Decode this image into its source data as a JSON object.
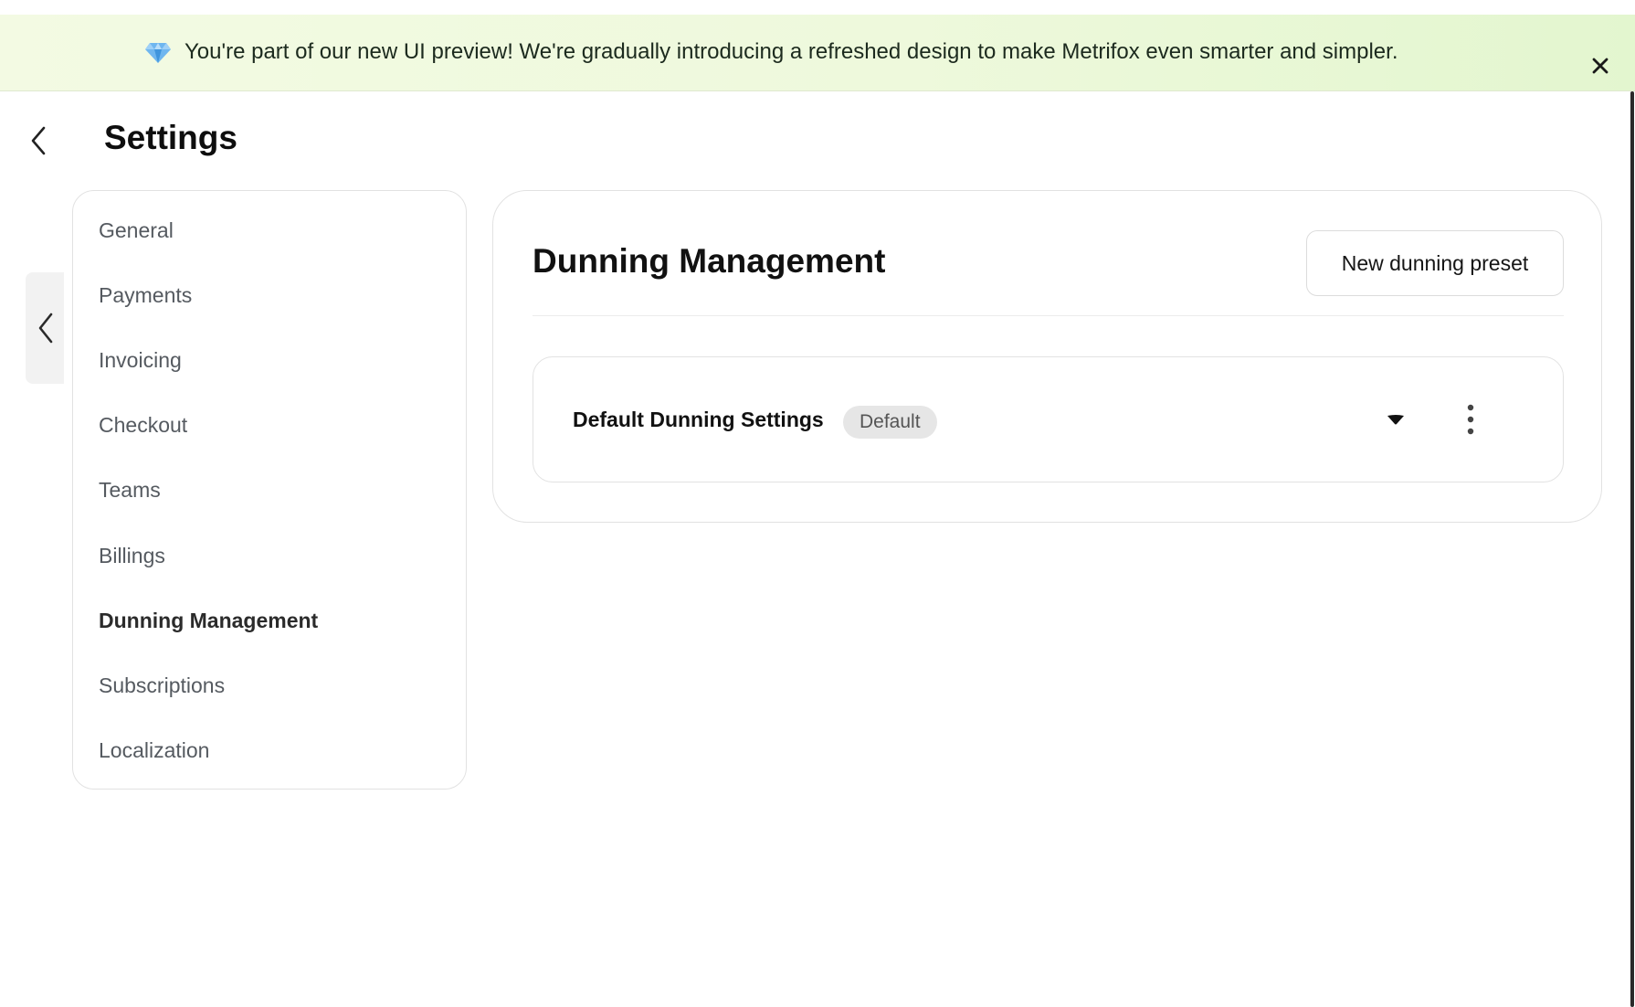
{
  "banner": {
    "message": "You're part of our new UI preview! We're gradually introducing a refreshed design to make Metrifox even smarter and simpler.",
    "icon": "gem-icon",
    "close_icon": "close-icon"
  },
  "header": {
    "title": "Settings",
    "back_icon": "chevron-left-icon"
  },
  "sidebar": {
    "collapse_icon": "chevron-left-icon",
    "items": [
      {
        "label": "General",
        "active": false
      },
      {
        "label": "Payments",
        "active": false
      },
      {
        "label": "Invoicing",
        "active": false
      },
      {
        "label": "Checkout",
        "active": false
      },
      {
        "label": "Teams",
        "active": false
      },
      {
        "label": "Billings",
        "active": false
      },
      {
        "label": "Dunning Management",
        "active": true
      },
      {
        "label": "Subscriptions",
        "active": false
      },
      {
        "label": "Localization",
        "active": false
      }
    ]
  },
  "main": {
    "title": "Dunning Management",
    "new_preset_label": "New dunning preset",
    "presets": [
      {
        "name": "Default Dunning Settings",
        "badge": "Default",
        "expand_icon": "caret-down-icon",
        "menu_icon": "more-vertical-icon"
      }
    ]
  },
  "colors": {
    "banner_start": "#f3fae3",
    "banner_end": "#e3f6cf",
    "border": "#e2e2e2",
    "badge_bg": "#e6e6e6",
    "muted_text": "#555a60"
  }
}
